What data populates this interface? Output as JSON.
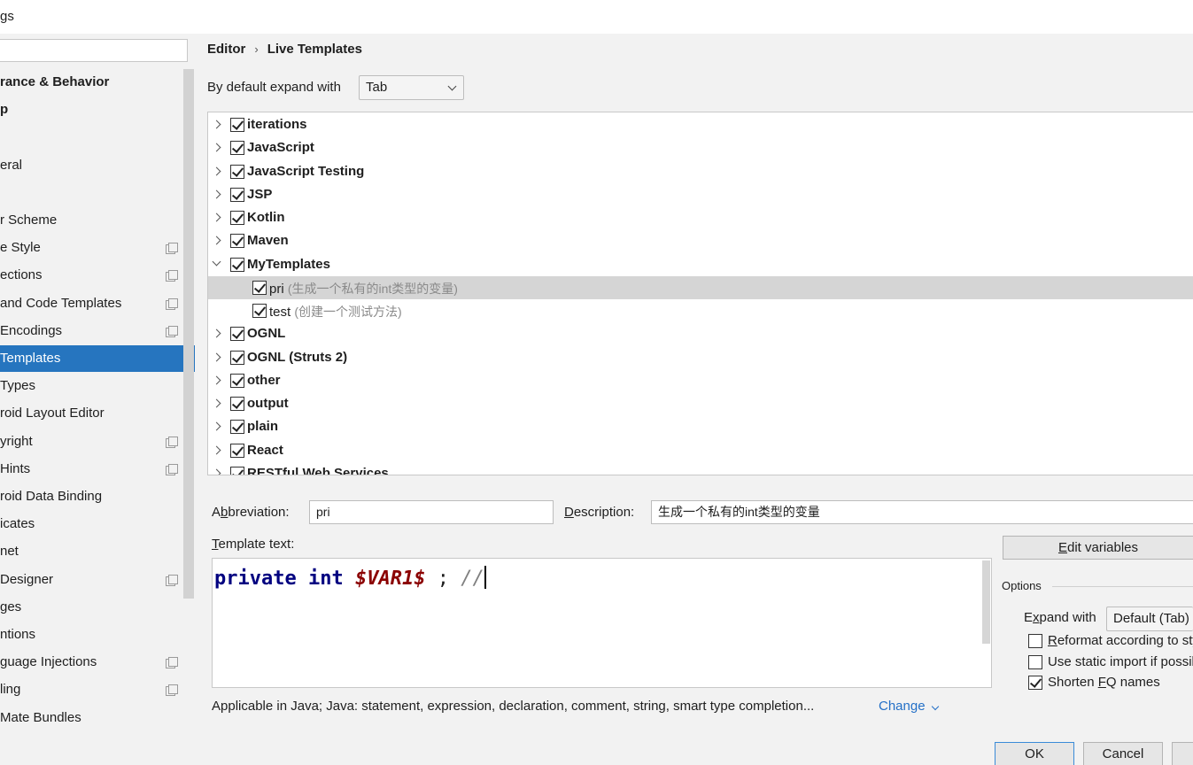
{
  "window": {
    "title": "gs"
  },
  "sidebar": {
    "items": [
      {
        "label": "rance & Behavior",
        "bold": true,
        "gear": false,
        "selected": false
      },
      {
        "label": "p",
        "bold": true,
        "gear": false,
        "selected": false
      },
      {
        "label": "",
        "bold": false,
        "gear": false,
        "selected": false
      },
      {
        "label": "eral",
        "bold": false,
        "gear": false,
        "selected": false
      },
      {
        "label": "",
        "bold": false,
        "gear": false,
        "selected": false
      },
      {
        "label": "r Scheme",
        "bold": false,
        "gear": false,
        "selected": false
      },
      {
        "label": "e Style",
        "bold": false,
        "gear": true,
        "selected": false
      },
      {
        "label": "ections",
        "bold": false,
        "gear": true,
        "selected": false
      },
      {
        "label": "and Code Templates",
        "bold": false,
        "gear": true,
        "selected": false
      },
      {
        "label": "Encodings",
        "bold": false,
        "gear": true,
        "selected": false
      },
      {
        "label": "Templates",
        "bold": false,
        "gear": false,
        "selected": true
      },
      {
        "label": "Types",
        "bold": false,
        "gear": false,
        "selected": false
      },
      {
        "label": "roid Layout Editor",
        "bold": false,
        "gear": false,
        "selected": false
      },
      {
        "label": "yright",
        "bold": false,
        "gear": true,
        "selected": false
      },
      {
        "label": " Hints",
        "bold": false,
        "gear": true,
        "selected": false
      },
      {
        "label": "roid Data Binding",
        "bold": false,
        "gear": false,
        "selected": false
      },
      {
        "label": "icates",
        "bold": false,
        "gear": false,
        "selected": false
      },
      {
        "label": "net",
        "bold": false,
        "gear": false,
        "selected": false
      },
      {
        "label": "Designer",
        "bold": false,
        "gear": true,
        "selected": false
      },
      {
        "label": "ges",
        "bold": false,
        "gear": false,
        "selected": false
      },
      {
        "label": "ntions",
        "bold": false,
        "gear": false,
        "selected": false
      },
      {
        "label": "guage Injections",
        "bold": false,
        "gear": true,
        "selected": false
      },
      {
        "label": "ling",
        "bold": false,
        "gear": true,
        "selected": false
      },
      {
        "label": "Mate Bundles",
        "bold": false,
        "gear": false,
        "selected": false
      }
    ]
  },
  "breadcrumb": {
    "parent": "Editor",
    "separator": "›",
    "current": "Live Templates"
  },
  "expand_default": {
    "label": "By default expand with",
    "value": "Tab"
  },
  "templates": [
    {
      "label": "iterations",
      "level": 0,
      "expanded": false,
      "checked": true,
      "selected": false,
      "desc": ""
    },
    {
      "label": "JavaScript",
      "level": 0,
      "expanded": false,
      "checked": true,
      "selected": false,
      "desc": ""
    },
    {
      "label": "JavaScript Testing",
      "level": 0,
      "expanded": false,
      "checked": true,
      "selected": false,
      "desc": ""
    },
    {
      "label": "JSP",
      "level": 0,
      "expanded": false,
      "checked": true,
      "selected": false,
      "desc": ""
    },
    {
      "label": "Kotlin",
      "level": 0,
      "expanded": false,
      "checked": true,
      "selected": false,
      "desc": ""
    },
    {
      "label": "Maven",
      "level": 0,
      "expanded": false,
      "checked": true,
      "selected": false,
      "desc": ""
    },
    {
      "label": "MyTemplates",
      "level": 0,
      "expanded": true,
      "checked": true,
      "selected": false,
      "desc": ""
    },
    {
      "label": "pri",
      "level": 1,
      "expanded": false,
      "checked": true,
      "selected": true,
      "desc": "(生成一个私有的int类型的变量)"
    },
    {
      "label": "test",
      "level": 1,
      "expanded": false,
      "checked": true,
      "selected": false,
      "desc": "(创建一个测试方法)"
    },
    {
      "label": "OGNL",
      "level": 0,
      "expanded": false,
      "checked": true,
      "selected": false,
      "desc": ""
    },
    {
      "label": "OGNL (Struts 2)",
      "level": 0,
      "expanded": false,
      "checked": true,
      "selected": false,
      "desc": ""
    },
    {
      "label": "other",
      "level": 0,
      "expanded": false,
      "checked": true,
      "selected": false,
      "desc": ""
    },
    {
      "label": "output",
      "level": 0,
      "expanded": false,
      "checked": true,
      "selected": false,
      "desc": ""
    },
    {
      "label": "plain",
      "level": 0,
      "expanded": false,
      "checked": true,
      "selected": false,
      "desc": ""
    },
    {
      "label": "React",
      "level": 0,
      "expanded": false,
      "checked": true,
      "selected": false,
      "desc": ""
    },
    {
      "label": "RESTful Web Services",
      "level": 0,
      "expanded": false,
      "checked": true,
      "selected": false,
      "desc": ""
    }
  ],
  "abbreviation": {
    "label_pre": "A",
    "label_u": "b",
    "label_post": "breviation:",
    "value": "pri"
  },
  "description": {
    "label_u": "D",
    "label_post": "escription:",
    "value": "生成一个私有的int类型的变量"
  },
  "template_text": {
    "label_u": "T",
    "label_post": "emplate text:",
    "code": {
      "kw1": "private",
      "kw2": "int",
      "var": "$VAR1$",
      "semi": ";",
      "comment": "//"
    }
  },
  "edit_variables": {
    "label_u": "E",
    "label_post": "dit variables"
  },
  "options": {
    "title": "Options",
    "expand_with": {
      "label_pre": "E",
      "label_u": "x",
      "label_post": "pand with",
      "value": "Default (Tab)"
    },
    "reformat": {
      "label_u": "R",
      "label_post": "eformat according to style",
      "checked": false
    },
    "static_import": {
      "label_post": "Use static import if possible",
      "checked": false
    },
    "shorten_fq": {
      "label_pre": "Shorten ",
      "label_u": "F",
      "label_post": "Q names",
      "checked": true
    }
  },
  "applicable": {
    "text": "Applicable in Java; Java: statement, expression, declaration, comment, string, smart type completion...",
    "link": "Change"
  },
  "footer": {
    "ok": "OK",
    "cancel": "Cancel"
  }
}
